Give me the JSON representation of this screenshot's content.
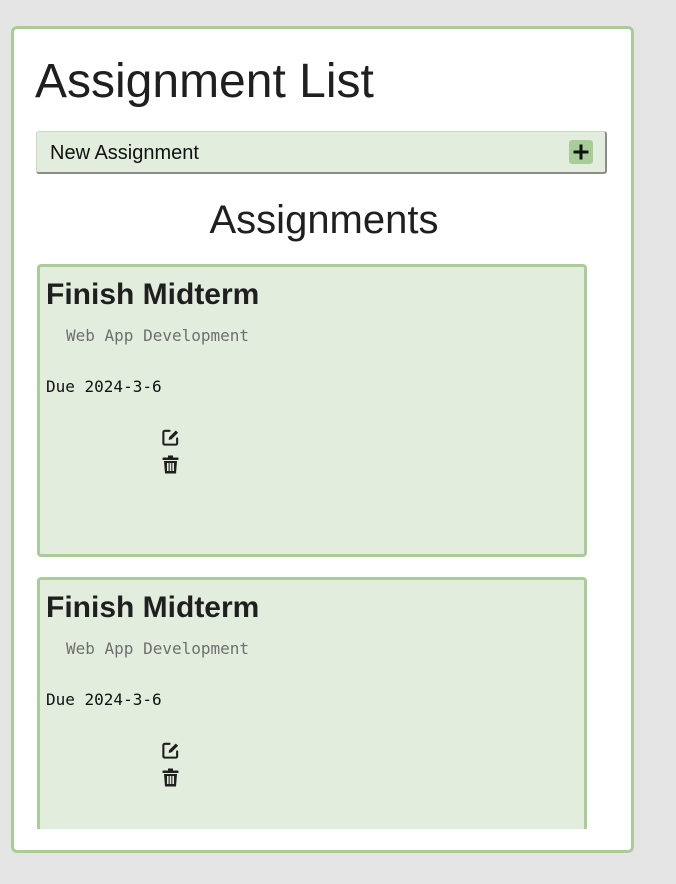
{
  "app": {
    "title": "Assignment List"
  },
  "new_assignment": {
    "label": "New Assignment",
    "add_icon": "plus-icon"
  },
  "section": {
    "title": "Assignments"
  },
  "assignments": [
    {
      "title": "Finish Midterm",
      "course": "Web App Development",
      "due": "Due 2024-3-6"
    },
    {
      "title": "Finish Midterm",
      "course": "Web App Development",
      "due": "Due 2024-3-6"
    }
  ],
  "icons": {
    "edit": "edit-icon",
    "delete": "trash-icon"
  },
  "colors": {
    "accent_green": "#a9cd9a",
    "card_bg": "#e2eddd",
    "page_bg": "#e5e5e5"
  }
}
